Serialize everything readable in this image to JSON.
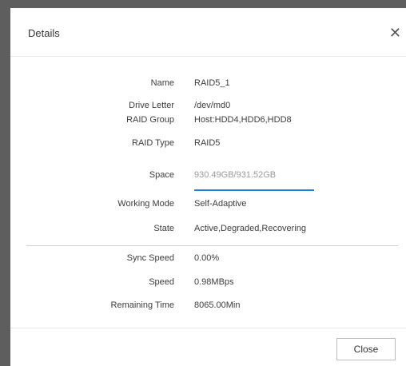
{
  "dialog": {
    "title": "Details",
    "close_icon": "close-icon"
  },
  "fields": [
    {
      "label": "Name",
      "value": "RAID5_1"
    },
    {
      "label": "Drive Letter",
      "value": "/dev/md0"
    },
    {
      "label": "RAID Group",
      "value": "Host:HDD4,HDD6,HDD8"
    },
    {
      "label": "RAID Type",
      "value": "RAID5"
    },
    {
      "label": "Space",
      "value": "930.49GB/931.52GB"
    },
    {
      "label": "Working Mode",
      "value": "Self-Adaptive"
    },
    {
      "label": "State",
      "value": "Active,Degraded,Recovering"
    }
  ],
  "sync": [
    {
      "label": "Sync Speed",
      "value": "0.00%"
    },
    {
      "label": "Speed",
      "value": "0.98MBps"
    },
    {
      "label": "Remaining Time",
      "value": "8065.00Min"
    }
  ],
  "space_usage_fraction": 0.9989,
  "colors": {
    "progress": "#1f7ee6",
    "text": "#3c3c3c",
    "muted": "#9a9a9a"
  },
  "footer": {
    "close_label": "Close"
  }
}
